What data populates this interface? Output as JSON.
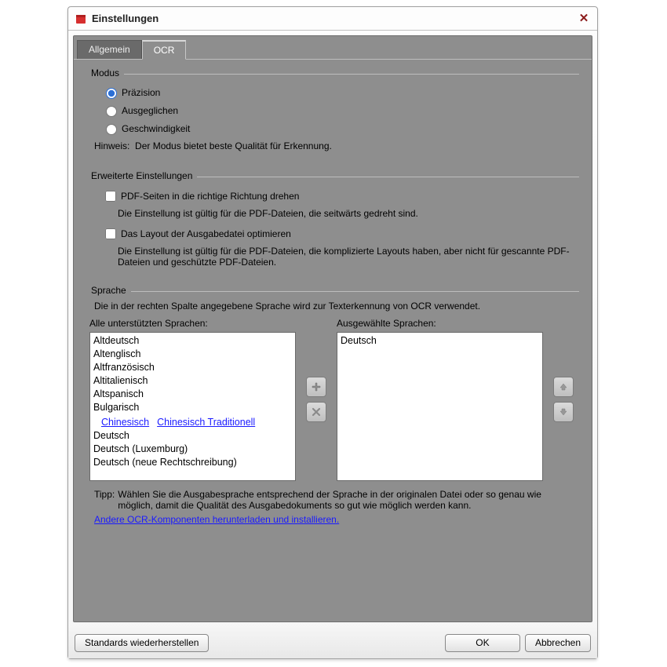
{
  "window": {
    "title": "Einstellungen"
  },
  "tabs": {
    "general": "Allgemein",
    "ocr": "OCR"
  },
  "mode": {
    "group": "Modus",
    "options": {
      "precision": "Präzision",
      "balanced": "Ausgeglichen",
      "speed": "Geschwindigkeit"
    },
    "hint_label": "Hinweis:",
    "hint_text": "Der Modus bietet beste Qualität für Erkennung."
  },
  "advanced": {
    "group": "Erweiterte Einstellungen",
    "rotate_label": "PDF-Seiten in die richtige Richtung drehen",
    "rotate_note": "Die Einstellung ist gültig für die PDF-Dateien, die seitwärts gedreht sind.",
    "layout_label": "Das Layout der Ausgabedatei optimieren",
    "layout_note": "Die Einstellung ist gültig für die PDF-Dateien, die komplizierte Layouts haben, aber nicht für gescannte PDF-Dateien und geschützte PDF-Dateien."
  },
  "language": {
    "group": "Sprache",
    "desc": "Die in der rechten Spalte angegebene Sprache wird zur Texterkennung von OCR verwendet.",
    "all_label": "Alle unterstützten Sprachen:",
    "sel_label": "Ausgewählte Sprachen:",
    "all": [
      {
        "t": "Altdeutsch",
        "l": false
      },
      {
        "t": "Altenglisch",
        "l": false
      },
      {
        "t": "Altfranzösisch",
        "l": false
      },
      {
        "t": "Altitalienisch",
        "l": false
      },
      {
        "t": "Altspanisch",
        "l": false
      },
      {
        "t": "Bulgarisch",
        "l": false
      },
      {
        "t": "Chinesisch",
        "l": true
      },
      {
        "t": "Chinesisch Traditionell",
        "l": true
      },
      {
        "t": "Deutsch",
        "l": false
      },
      {
        "t": "Deutsch (Luxemburg)",
        "l": false
      },
      {
        "t": "Deutsch (neue Rechtschreibung)",
        "l": false
      }
    ],
    "selected": [
      "Deutsch"
    ],
    "tip_label": "Tipp:",
    "tip_text": "Wählen Sie die Ausgabesprache entsprechend der Sprache in der originalen Datei oder so genau wie möglich, damit die Qualität des Ausgabedokuments so gut wie möglich werden kann.",
    "download_link": "Andere OCR-Komponenten herunterladen und installieren."
  },
  "footer": {
    "restore": "Standards wiederherstellen",
    "ok": "OK",
    "cancel": "Abbrechen"
  }
}
